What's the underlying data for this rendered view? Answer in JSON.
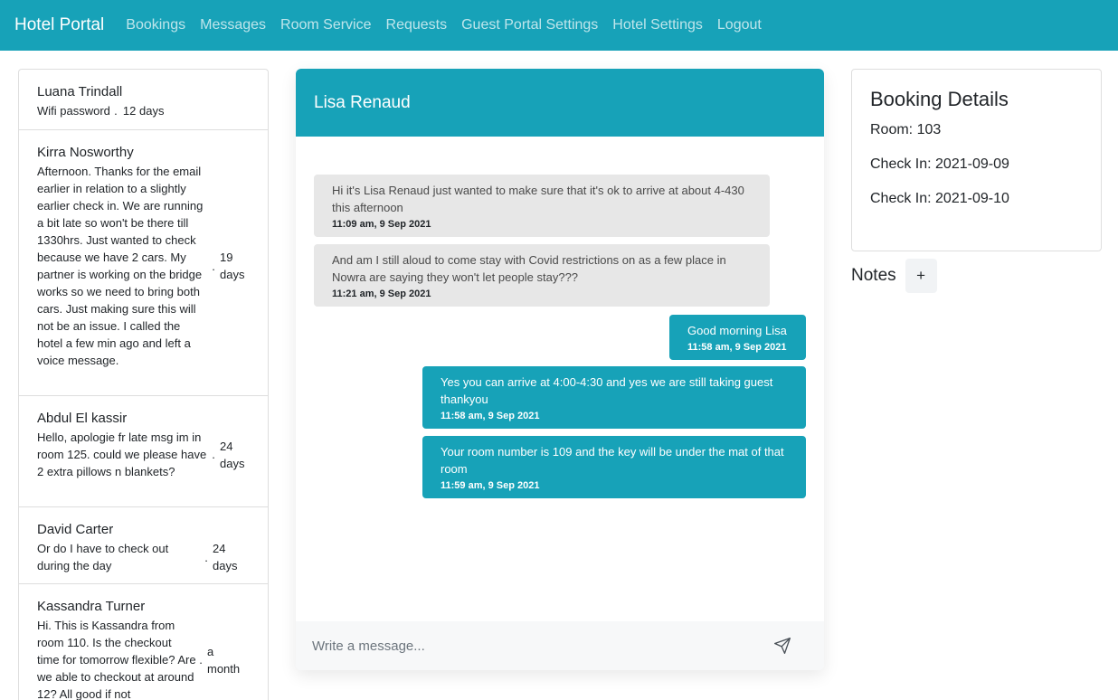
{
  "navbar": {
    "brand": "Hotel Portal",
    "links": [
      "Bookings",
      "Messages",
      "Room Service",
      "Requests",
      "Guest Portal Settings",
      "Hotel Settings",
      "Logout"
    ]
  },
  "conversations": [
    {
      "name": "Luana Trindall",
      "preview": "Wifi password",
      "ago": "12 days"
    },
    {
      "name": "Kirra Nosworthy",
      "preview": "Afternoon. Thanks for the email earlier in relation to a slightly earlier check in. We are running a bit late so won't be there till 1330hrs. Just wanted to check because we have 2 cars. My partner is working on the bridge works so we need to bring both cars. Just making sure this will not be an issue. I called the hotel a few min ago and left a voice message.",
      "ago": "19 days"
    },
    {
      "name": "Abdul El kassir",
      "preview": "Hello, apologie fr late msg im in room 125. could we please have 2 extra pillows n blankets?",
      "ago": "24 days"
    },
    {
      "name": "David Carter",
      "preview": "Or do I have to check out during the day",
      "ago": "24 days"
    },
    {
      "name": "Kassandra Turner",
      "preview": "Hi. This is Kassandra from room 110. Is the checkout time for tomorrow flexible? Are we able to checkout at around 12? All good if not",
      "ago": "a month"
    }
  ],
  "chat": {
    "guest_name": "Lisa Renaud",
    "messages": [
      {
        "direction": "in",
        "text": "Hi it's Lisa Renaud just wanted to make sure that it's ok to arrive at about 4-430 this afternoon",
        "time": "11:09 am, 9 Sep 2021"
      },
      {
        "direction": "in",
        "text": "And am I still aloud to come stay with Covid restrictions on as a few place in Nowra are saying they won't let people stay???",
        "time": "11:21 am, 9 Sep 2021"
      },
      {
        "direction": "out",
        "text": "Good morning Lisa",
        "time": "11:58 am, 9 Sep 2021"
      },
      {
        "direction": "out",
        "text": "Yes you can arrive at 4:00-4:30 and yes we are still taking guest thankyou",
        "time": "11:58 am, 9 Sep 2021"
      },
      {
        "direction": "out",
        "text": "Your room number is 109 and the key will be under the mat of that room",
        "time": "11:59 am, 9 Sep 2021"
      }
    ],
    "composer_placeholder": "Write a message..."
  },
  "booking": {
    "title": "Booking Details",
    "room": "Room: 103",
    "check_in": "Check In: 2021-09-09",
    "check_out": "Check In: 2021-09-10"
  },
  "notes": {
    "title": "Notes",
    "add_label": "+"
  },
  "colors": {
    "primary": "#17a2b8",
    "incoming_bubble": "#e7e7e7"
  }
}
